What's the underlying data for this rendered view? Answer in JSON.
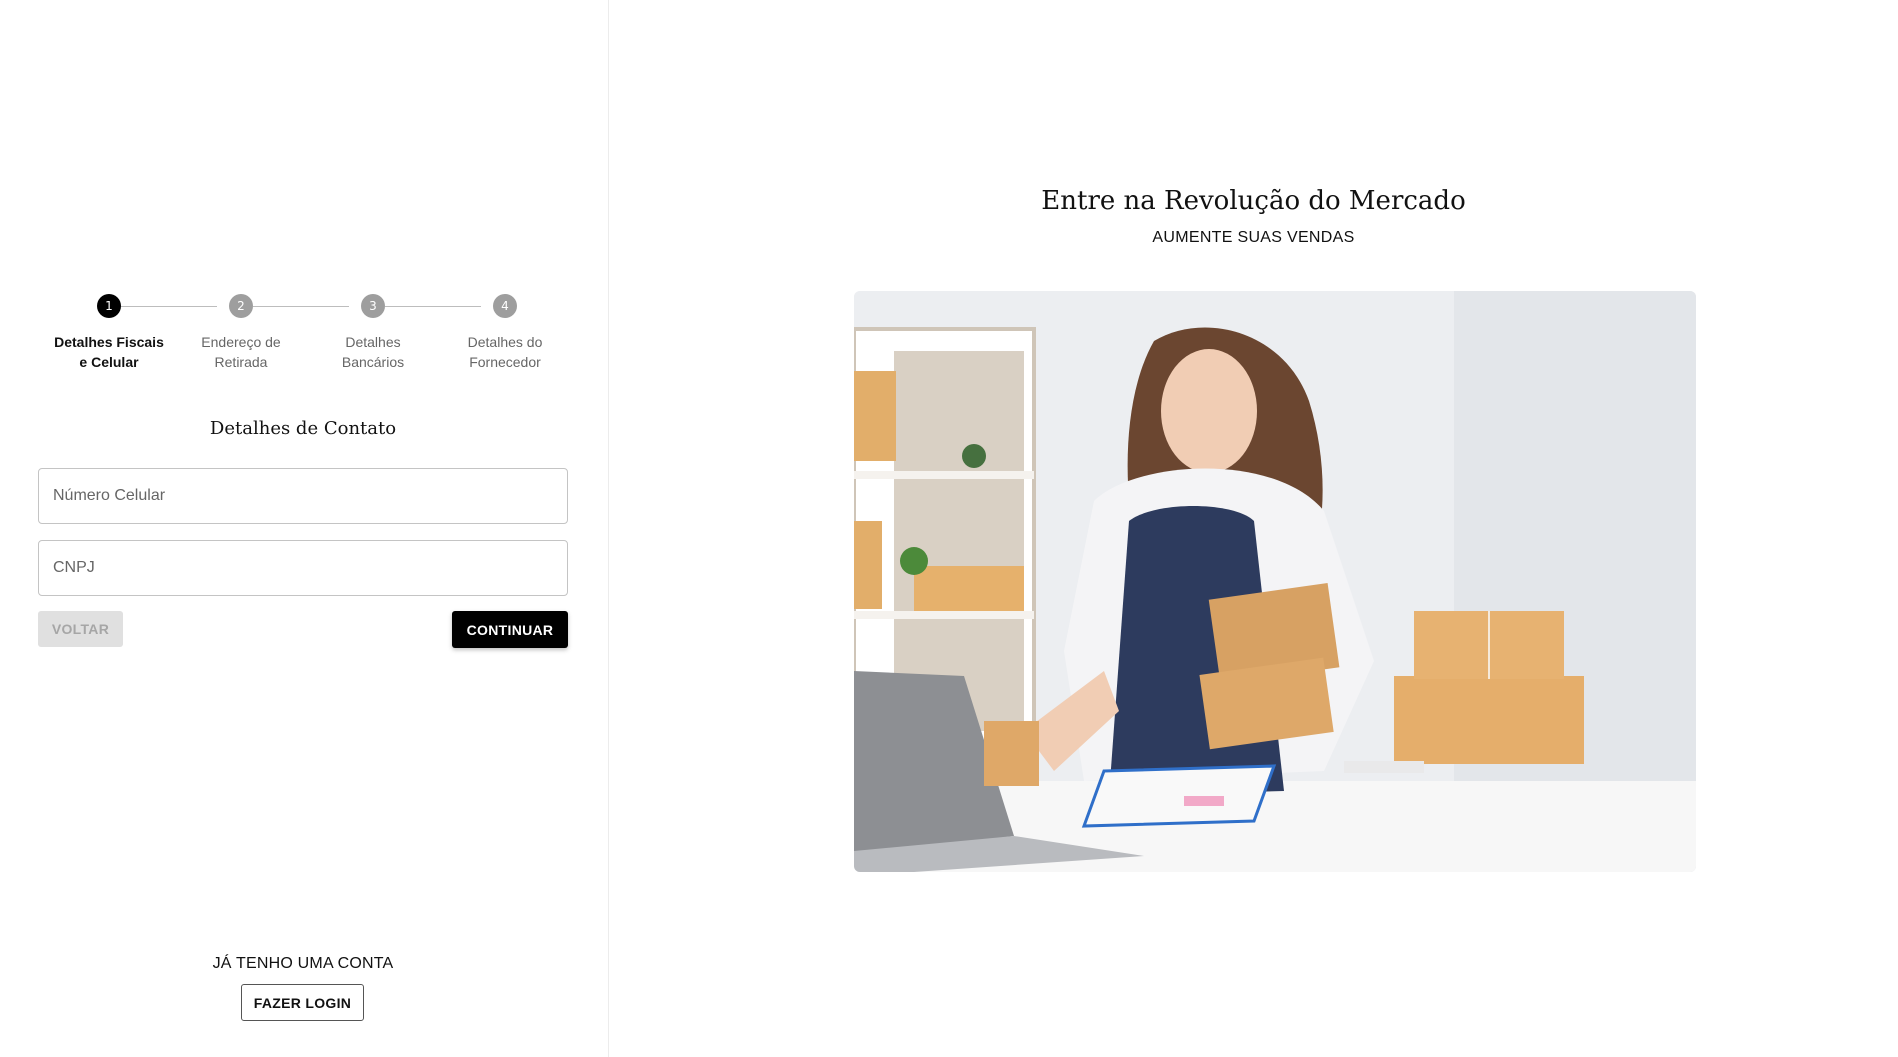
{
  "stepper": {
    "steps": [
      {
        "number": "1",
        "label": "Detalhes Fiscais e Celular"
      },
      {
        "number": "2",
        "label": "Endereço de Retirada"
      },
      {
        "number": "3",
        "label": "Detalhes Bancários"
      },
      {
        "number": "4",
        "label": "Detalhes do Fornecedor"
      }
    ],
    "active_step": 1
  },
  "form": {
    "title": "Detalhes de Contato",
    "phone_placeholder": "Número Celular",
    "phone_value": "",
    "cnpj_placeholder": "CNPJ",
    "cnpj_value": "",
    "back_label": "VOLTAR",
    "continue_label": "CONTINUAR"
  },
  "account": {
    "prompt": "JÁ TENHO UMA CONTA",
    "login_label": "FAZER LOGIN"
  },
  "hero": {
    "title": "Entre na Revolução do Mercado",
    "subtitle": "AUMENTE SUAS VENDAS"
  },
  "colors": {
    "active_step": "#000000",
    "inactive_step": "#9e9e9e",
    "primary_button": "#000000",
    "disabled_button": "#e0e0e0"
  }
}
